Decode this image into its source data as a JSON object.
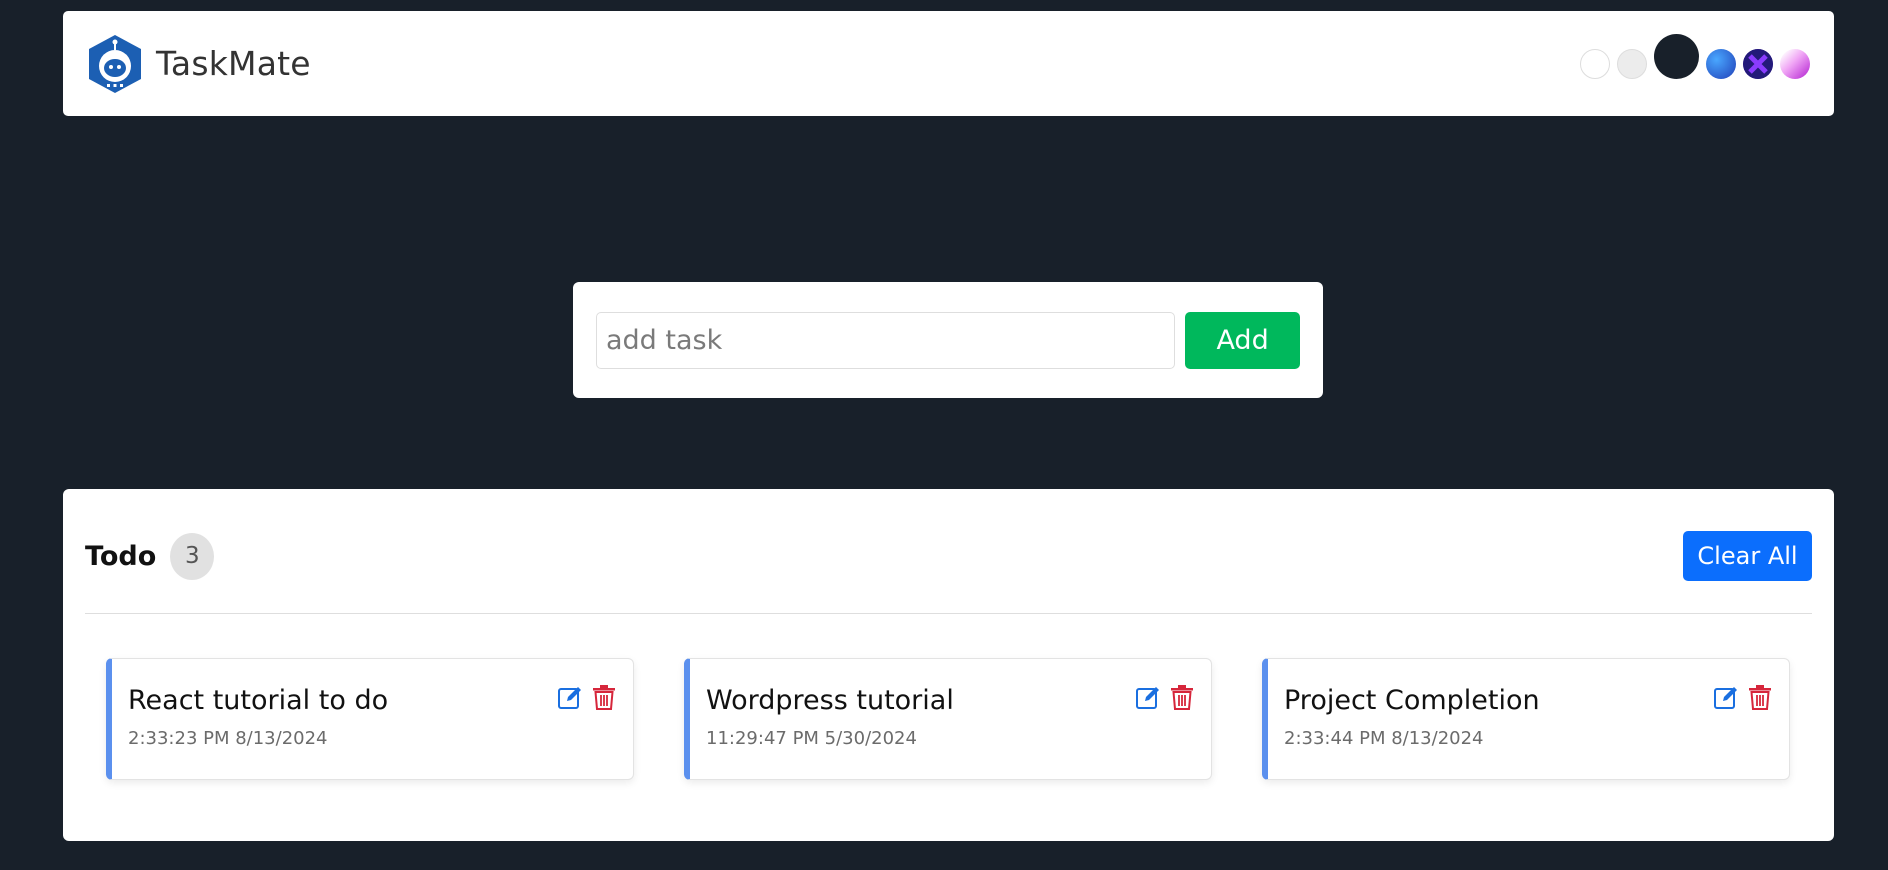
{
  "header": {
    "brand": "TaskMate",
    "logo_icon": "astronaut-icon",
    "themes": [
      {
        "name": "light",
        "color": "#ffffff"
      },
      {
        "name": "medium",
        "color": "#ececec"
      },
      {
        "name": "dark",
        "color": "#18202a"
      },
      {
        "name": "gOne",
        "color": "#2c6de0"
      },
      {
        "name": "gTwo",
        "color": "#4a1fb8"
      },
      {
        "name": "gThree",
        "color": "#d667e8"
      }
    ]
  },
  "add_task": {
    "placeholder": "add task",
    "value": "",
    "button_label": "Add",
    "button_color": "#00b85c"
  },
  "todo": {
    "title": "Todo",
    "count": "3",
    "clear_label": "Clear All",
    "clear_color": "#0b6efd",
    "tasks": [
      {
        "name": "React tutorial to do",
        "time": "2:33:23 PM 8/13/2024"
      },
      {
        "name": "Wordpress tutorial",
        "time": "11:29:47 PM 5/30/2024"
      },
      {
        "name": "Project Completion",
        "time": "2:33:44 PM 8/13/2024"
      }
    ],
    "edit_icon": "edit-icon",
    "delete_icon": "trash-icon",
    "accent_color": "#5b90ee"
  },
  "colors": {
    "background": "#18202a",
    "edit": "#1a6fe0",
    "delete": "#d6263b"
  }
}
